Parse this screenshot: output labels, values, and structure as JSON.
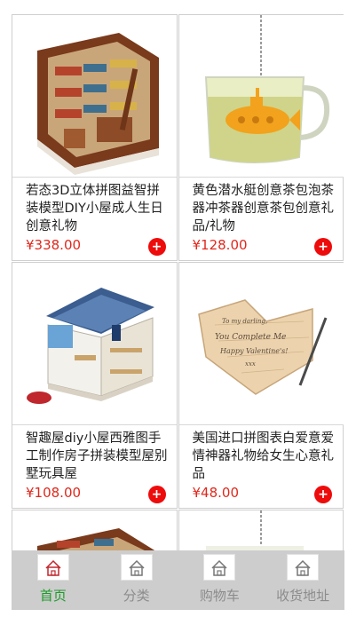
{
  "products": [
    {
      "title": "若态3D立体拼图益智拼装模型DIY小屋成人生日创意礼物",
      "price": "¥338.00",
      "add_label": "+"
    },
    {
      "title": "黄色潜水艇创意茶包泡茶器冲茶器创意茶包创意礼品/礼物",
      "price": "¥128.00",
      "add_label": "+"
    },
    {
      "title": "智趣屋diy小屋西雅图手工制作房子拼装模型屋别墅玩具屋",
      "price": "¥108.00",
      "add_label": "+"
    },
    {
      "title": "美国进口拼图表白爱意爱情神器礼物给女生心意礼品",
      "price": "¥48.00",
      "add_label": "+"
    }
  ],
  "card_art": {
    "heart_line1": "To my darling,",
    "heart_line2": "You Complete Me",
    "heart_line3": "Happy Valentine's!",
    "heart_line4": "xxx"
  },
  "tabbar": {
    "items": [
      {
        "label": "首页",
        "icon": "home-icon",
        "active": true
      },
      {
        "label": "分类",
        "icon": "home-icon",
        "active": false
      },
      {
        "label": "购物车",
        "icon": "home-icon",
        "active": false
      },
      {
        "label": "收货地址",
        "icon": "home-icon",
        "active": false
      }
    ],
    "active_color": "#1e9a2a",
    "inactive_color": "#8c8c8c"
  },
  "colors": {
    "price": "#e0281c",
    "add_button": "#ee0b0b"
  }
}
